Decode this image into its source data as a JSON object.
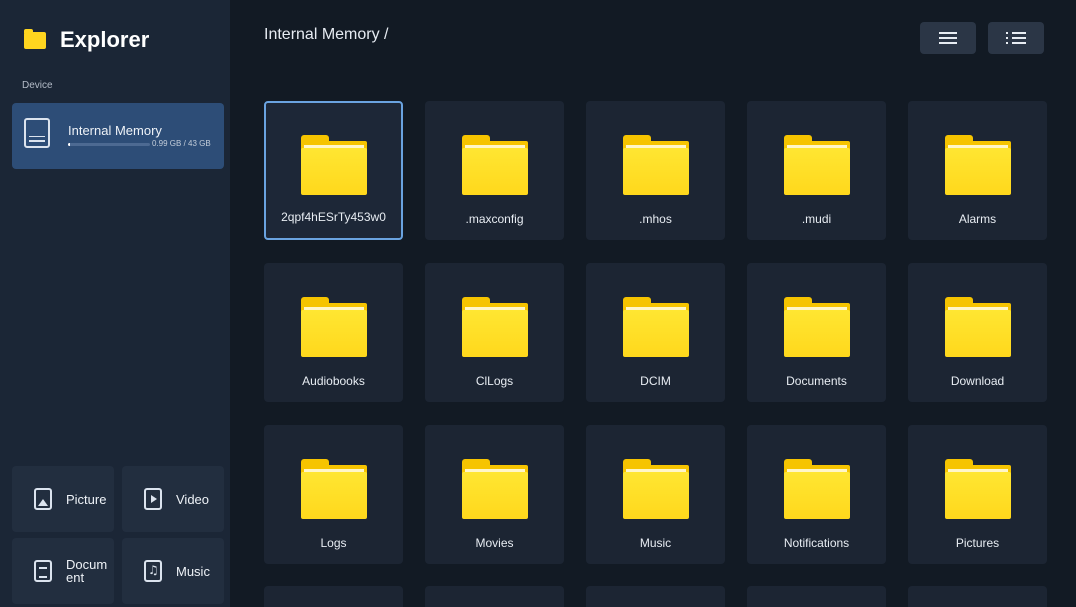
{
  "app": {
    "title": "Explorer"
  },
  "sidebar": {
    "section_label": "Device",
    "storage": {
      "name": "Internal Memory",
      "size": "0.99 GB / 43 GB",
      "used_fraction": 0.023
    },
    "categories": [
      {
        "label": "Picture",
        "icon": "picture-icon"
      },
      {
        "label": "Video",
        "icon": "video-icon"
      },
      {
        "label": "Document",
        "icon": "document-icon"
      },
      {
        "label": "Music",
        "icon": "music-icon"
      }
    ]
  },
  "main": {
    "breadcrumb": "Internal Memory /",
    "view_buttons": [
      "grid-view",
      "list-view"
    ],
    "folders": [
      "2qpf4hESrTy453w0",
      ".maxconfig",
      ".mhos",
      ".mudi",
      "Alarms",
      "Audiobooks",
      "ClLogs",
      "DCIM",
      "Documents",
      "Download",
      "Logs",
      "Movies",
      "Music",
      "Notifications",
      "Pictures"
    ]
  },
  "colors": {
    "background": "#121a24",
    "sidebar": "#1b2636",
    "selected": "#2d4d77",
    "folder": "#ffd81c",
    "focus": "#6aa3e0"
  }
}
